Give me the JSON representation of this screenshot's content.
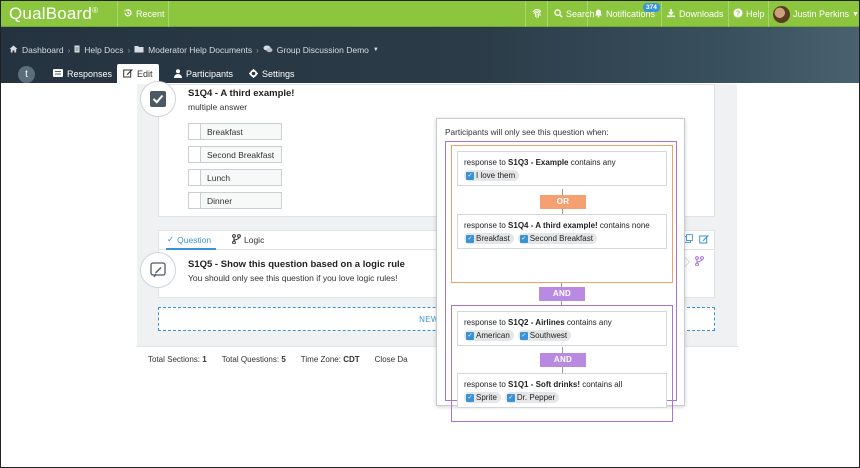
{
  "app": {
    "logo": "QualBoard",
    "logo_mark": "®"
  },
  "topbar": {
    "recent": "Recent",
    "search": "Search",
    "notifications": "Notifications",
    "notifications_count": "374",
    "downloads": "Downloads",
    "help": "Help",
    "user": "Justin Perkins"
  },
  "breadcrumb": {
    "items": [
      "Dashboard",
      "Help Docs",
      "Moderator Help Documents",
      "Group Discussion Demo"
    ]
  },
  "tabs": {
    "responses": "Responses",
    "edit": "Edit",
    "participants": "Participants",
    "settings": "Settings",
    "t": "t"
  },
  "q4": {
    "title": "S1Q4 - A third example!",
    "subtitle": "multiple answer",
    "options": [
      "Breakfast",
      "Second Breakfast",
      "Lunch",
      "Dinner"
    ]
  },
  "qtabs": {
    "question": "Question",
    "logic": "Logic"
  },
  "q5": {
    "title": "S1Q5 - Show this question based on a logic rule",
    "subtitle": "You should only see this question if you love logic rules!"
  },
  "new_question": "NEW QU",
  "footer": {
    "sections_label": "Total Sections:",
    "sections": "1",
    "questions_label": "Total Questions:",
    "questions": "5",
    "tz_label": "Time Zone:",
    "tz": "CDT",
    "close_label": "Close Da"
  },
  "popover": {
    "caption": "Participants will only see this question when:",
    "or_label": "OR",
    "and_label": "AND",
    "and_label2": "AND",
    "c1": {
      "prefix": "response to ",
      "q": "S1Q3 - Example",
      "suffix": " contains any",
      "chips": [
        "I love them"
      ]
    },
    "c2": {
      "prefix": "response to ",
      "q": "S1Q4 - A third example!",
      "suffix": " contains none",
      "chips": [
        "Breakfast",
        "Second Breakfast"
      ]
    },
    "c3": {
      "prefix": "response to ",
      "q": "S1Q2 - Airlines",
      "suffix": " contains any",
      "chips": [
        "American",
        "Southwest"
      ]
    },
    "c4": {
      "prefix": "response to ",
      "q": "S1Q1 - Soft drinks!",
      "suffix": " contains all",
      "chips": [
        "Sprite",
        "Dr. Pepper"
      ]
    }
  },
  "colors": {
    "brand": "#8cc63f",
    "dark": "#24333f",
    "link": "#3a93d5",
    "or": "#f0a06a",
    "and": "#a873d8"
  }
}
